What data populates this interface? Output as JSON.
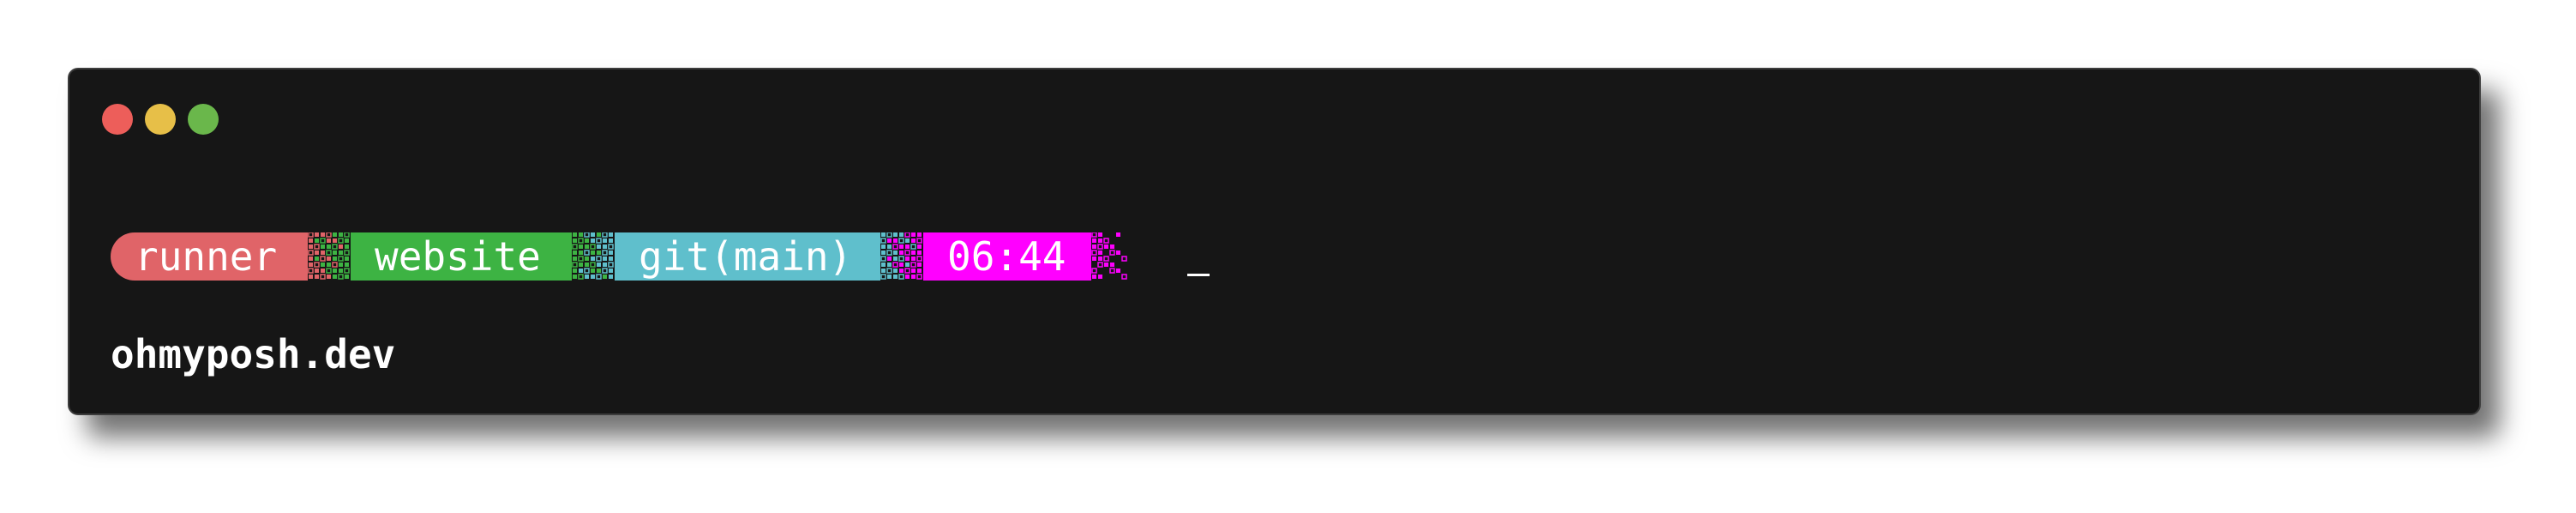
{
  "window": {
    "controls": [
      "close",
      "minimize",
      "zoom"
    ]
  },
  "prompt": {
    "segments": [
      {
        "label": "runner",
        "color": "#e06468"
      },
      {
        "label": "website",
        "color": "#3db343"
      },
      {
        "label": "git(main)",
        "color": "#5fbfcc"
      },
      {
        "label": "06:44",
        "color": "#ff00ff"
      }
    ]
  },
  "footer": {
    "text": "ohmyposh.dev"
  },
  "colors": {
    "terminal_bg": "#161616",
    "traffic_red": "#ed5e5a",
    "traffic_yellow": "#e7bf48",
    "traffic_green": "#6ab74b"
  }
}
